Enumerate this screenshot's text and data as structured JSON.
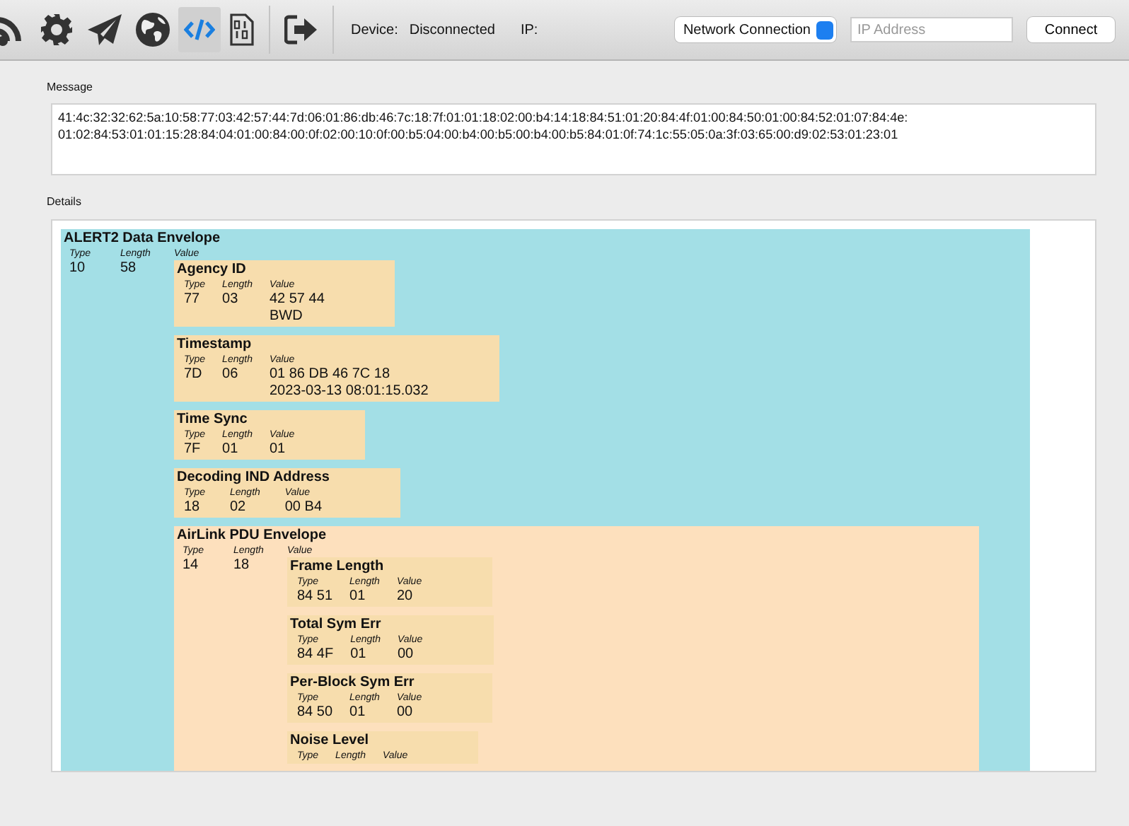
{
  "toolbar": {
    "tools": [
      {
        "kind": "feed",
        "selected": false
      },
      {
        "kind": "gear",
        "selected": false
      },
      {
        "kind": "plane",
        "selected": false
      },
      {
        "kind": "globe",
        "selected": false
      },
      {
        "kind": "code",
        "selected": true
      },
      {
        "kind": "binary",
        "selected": false
      },
      {
        "kind": "exit",
        "selected": false
      }
    ],
    "device_label": "Device:",
    "device_status": "Disconnected",
    "ip_label": "IP:",
    "connection_select": "Network Connection",
    "ip_field": {
      "placeholder": "IP Address"
    },
    "connect_button": "Connect"
  },
  "message": {
    "label": "Message",
    "text": "41:4c:32:32:62:5a:10:58:77:03:42:57:44:7d:06:01:86:db:46:7c:18:7f:01:01:18:02:00:b4:14:18:84:51:01:20:84:4f:01:00:84:50:01:00:84:52:01:07:84:4e: 01:02:84:53:01:01:15:28:84:04:01:00:84:00:0f:02:00:10:0f:00:b5:04:00:b4:00:b5:00:b4:00:b5:84:01:0f:74:1c:55:05:0a:3f:03:65:00:d9:02:53:01:23:01"
  },
  "details": {
    "label": "Details",
    "blocks": [
      {
        "kind": "envelope",
        "title": "ALERT2 Data Envelope",
        "headers": [
          "Type",
          "Length",
          "Value"
        ],
        "type": "10",
        "length": "58",
        "children": [
          {
            "kind": "element",
            "title": "Agency ID",
            "headers": [
              "Type",
              "Length",
              "Value"
            ],
            "type": "77",
            "length": "03",
            "value": [
              "42 57 44",
              "BWD"
            ]
          },
          {
            "kind": "element",
            "title": "Timestamp",
            "headers": [
              "Type",
              "Length",
              "Value"
            ],
            "type": "7D",
            "length": "06",
            "value": [
              "01 86 DB 46 7C 18",
              "2023-03-13 08:01:15.032"
            ]
          },
          {
            "kind": "element",
            "title": "Time Sync",
            "headers": [
              "Type",
              "Length",
              "Value"
            ],
            "type": "7F",
            "length": "01",
            "value": [
              "01"
            ]
          },
          {
            "kind": "element",
            "title": "Decoding IND Address",
            "headers": [
              "Type",
              "Length",
              "Value"
            ],
            "type": "18",
            "length": "02",
            "value": [
              "00 B4"
            ]
          },
          {
            "kind": "subenvelope",
            "title": "AirLink PDU Envelope",
            "headers": [
              "Type",
              "Length",
              "Value"
            ],
            "type": "14",
            "length": "18",
            "children": [
              {
                "kind": "element",
                "title": "Frame Length",
                "headers": [
                  "Type",
                  "Length",
                  "Value"
                ],
                "type": "84 51",
                "length": "01",
                "value": [
                  "20"
                ]
              },
              {
                "kind": "element",
                "title": "Total Sym Err",
                "headers": [
                  "Type",
                  "Length",
                  "Value"
                ],
                "type": "84 4F",
                "length": "01",
                "value": [
                  "00"
                ]
              },
              {
                "kind": "element",
                "title": "Per-Block Sym Err",
                "headers": [
                  "Type",
                  "Length",
                  "Value"
                ],
                "type": "84 50",
                "length": "01",
                "value": [
                  "00"
                ]
              },
              {
                "kind": "element",
                "title": "Noise Level",
                "headers": [
                  "Type",
                  "Length",
                  "Value"
                ]
              }
            ]
          }
        ]
      }
    ]
  }
}
